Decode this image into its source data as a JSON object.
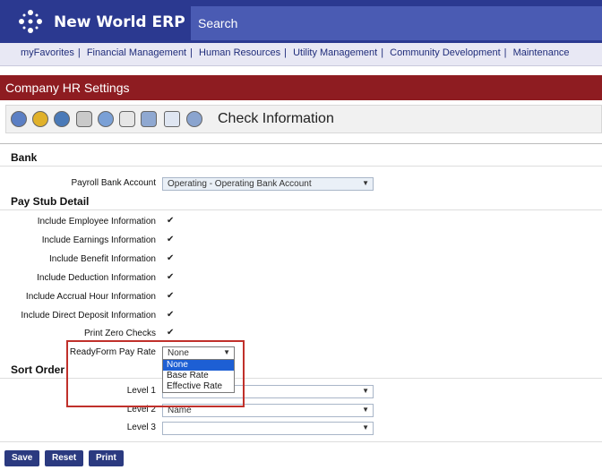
{
  "app": {
    "brand": "New World ERP",
    "search_placeholder": "Search"
  },
  "nav": [
    "myFavorites",
    "Financial Management",
    "Human Resources",
    "Utility Management",
    "Community Development",
    "Maintenance"
  ],
  "title": "Company HR Settings",
  "toolbar": {
    "heading": "Check Information",
    "icons": [
      "settings-icon",
      "hr-icon",
      "phone-icon",
      "lock-icon",
      "globe-icon",
      "number-icon",
      "calculator-icon",
      "document-icon",
      "check-icon"
    ]
  },
  "bank": {
    "section": "Bank",
    "payroll_label": "Payroll Bank Account",
    "payroll_value": "Operating - Operating Bank Account"
  },
  "paystub": {
    "section": "Pay Stub Detail",
    "checks": [
      "Include Employee Information",
      "Include Earnings Information",
      "Include Benefit Information",
      "Include Deduction Information",
      "Include Accrual Hour Information",
      "Include Direct Deposit Information",
      "Print Zero Checks"
    ],
    "readyform_label": "ReadyForm Pay Rate",
    "readyform_value": "None",
    "readyform_options": [
      "None",
      "Base Rate",
      "Effective Rate"
    ]
  },
  "sort": {
    "section": "Sort Order",
    "levels": [
      {
        "label": "Level 1",
        "value": ""
      },
      {
        "label": "Level 2",
        "value": "Name"
      },
      {
        "label": "Level 3",
        "value": ""
      }
    ]
  },
  "buttons": {
    "save": "Save",
    "reset": "Reset",
    "print": "Print"
  },
  "colors": {
    "header": "#2b3990",
    "title": "#8e1c21",
    "highlight": "#c0302b",
    "selected_option": "#1d5fd4"
  }
}
